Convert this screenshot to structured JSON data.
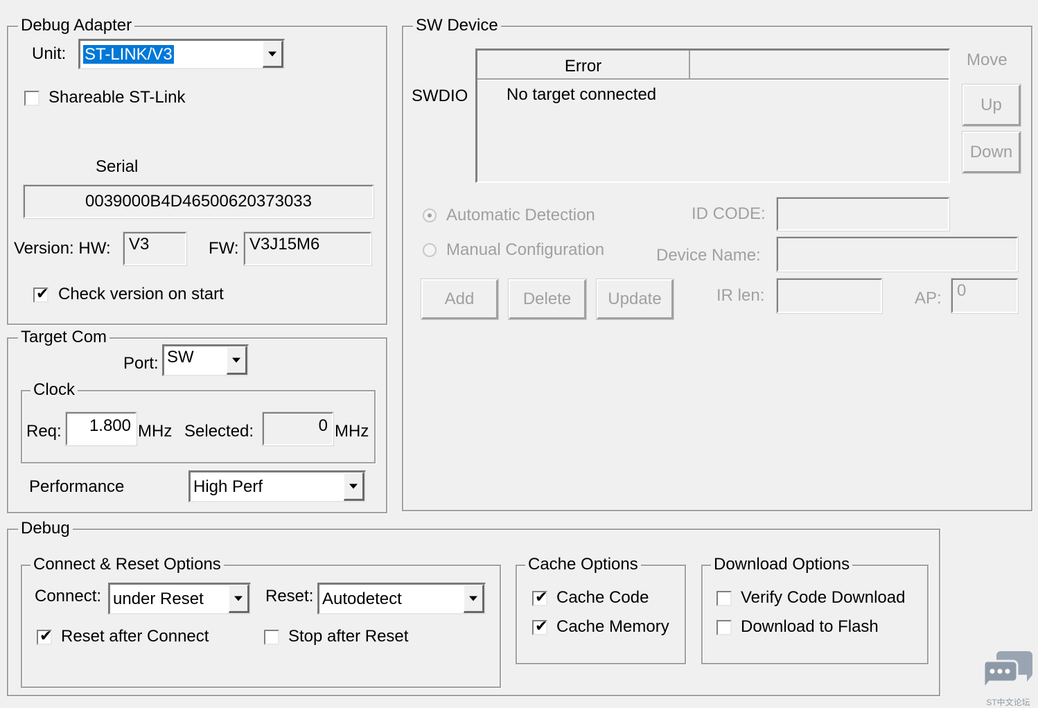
{
  "debug_adapter": {
    "title": "Debug Adapter",
    "unit_label": "Unit:",
    "unit_value": "ST-LINK/V3",
    "shareable_label": "Shareable ST-Link",
    "shareable_checked": false,
    "serial_label": "Serial",
    "serial_value": "0039000B4D46500620373033",
    "version_label": "Version: HW:",
    "hw_value": "V3",
    "fw_label": "FW:",
    "fw_value": "V3J15M6",
    "check_version_label": "Check version on start",
    "check_version_checked": true
  },
  "target_com": {
    "title": "Target Com",
    "port_label": "Port:",
    "port_value": "SW",
    "clock": {
      "title": "Clock",
      "req_label": "Req:",
      "req_value": "1.800",
      "req_unit": "MHz",
      "selected_label": "Selected:",
      "selected_value": "0",
      "selected_unit": "MHz"
    },
    "performance_label": "Performance",
    "performance_value": "High Perf"
  },
  "sw_device": {
    "title": "SW Device",
    "swdio_label": "SWDIO",
    "columns": [
      "Error",
      ""
    ],
    "rows": [
      [
        "No target connected",
        ""
      ]
    ],
    "move_label": "Move",
    "up_label": "Up",
    "down_label": "Down",
    "auto_detect_label": "Automatic Detection",
    "auto_detect_selected": true,
    "manual_config_label": "Manual Configuration",
    "manual_config_selected": false,
    "id_code_label": "ID CODE:",
    "id_code_value": "",
    "device_name_label": "Device Name:",
    "device_name_value": "",
    "ir_len_label": "IR len:",
    "ir_len_value": "",
    "ap_label": "AP:",
    "ap_value": "0",
    "add_label": "Add",
    "delete_label": "Delete",
    "update_label": "Update"
  },
  "debug": {
    "title": "Debug",
    "connect_reset": {
      "title": "Connect & Reset Options",
      "connect_label": "Connect:",
      "connect_value": "under Reset",
      "reset_label": "Reset:",
      "reset_value": "Autodetect",
      "reset_after_connect_label": "Reset after Connect",
      "reset_after_connect_checked": true,
      "stop_after_reset_label": "Stop after Reset",
      "stop_after_reset_checked": false
    },
    "cache": {
      "title": "Cache Options",
      "cache_code_label": "Cache Code",
      "cache_code_checked": true,
      "cache_memory_label": "Cache Memory",
      "cache_memory_checked": true
    },
    "download": {
      "title": "Download Options",
      "verify_label": "Verify Code Download",
      "verify_checked": false,
      "flash_label": "Download to Flash",
      "flash_checked": false
    }
  },
  "watermark": {
    "icon": "chat-bubbles-icon",
    "text": "ST中文论坛"
  }
}
